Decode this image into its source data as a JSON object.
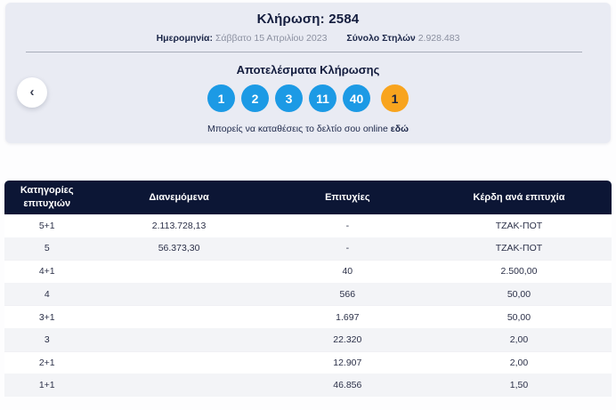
{
  "draw": {
    "title_label": "Κλήρωση:",
    "title_number": "2584",
    "date_label": "Ημερομηνία:",
    "date_value": "Σάββατο 15 Απριλίου 2023",
    "columns_label": "Σύνολο Στηλών",
    "columns_value": "2.928.483"
  },
  "results": {
    "heading": "Αποτελέσματα Κλήρωσης",
    "numbers": [
      "1",
      "2",
      "3",
      "11",
      "40"
    ],
    "joker": "1",
    "cta_text": "Μπορείς να καταθέσεις το δελτίο σου online",
    "cta_link": "εδώ",
    "back_icon_glyph": "‹"
  },
  "colors": {
    "card_bg": "#e9ebf3",
    "number_ball_blue": "#1c9ae5",
    "joker_ball_orange": "#f8a41e",
    "table_header_bg": "#0c1635",
    "navy_text": "#131c3d",
    "muted_text": "#8b90a0"
  },
  "table": {
    "headers": [
      "Κατηγορίες επιτυχιών",
      "Διανεμόμενα",
      "Επιτυχίες",
      "Κέρδη ανά επιτυχία"
    ],
    "rows": [
      {
        "category": "5+1",
        "distributed": "2.113.728,13",
        "winners": "-",
        "winnings": "ΤΖΑΚ-ΠΟΤ"
      },
      {
        "category": "5",
        "distributed": "56.373,30",
        "winners": "-",
        "winnings": "ΤΖΑΚ-ΠΟΤ"
      },
      {
        "category": "4+1",
        "distributed": "",
        "winners": "40",
        "winnings": "2.500,00"
      },
      {
        "category": "4",
        "distributed": "",
        "winners": "566",
        "winnings": "50,00"
      },
      {
        "category": "3+1",
        "distributed": "",
        "winners": "1.697",
        "winnings": "50,00"
      },
      {
        "category": "3",
        "distributed": "",
        "winners": "22.320",
        "winnings": "2,00"
      },
      {
        "category": "2+1",
        "distributed": "",
        "winners": "12.907",
        "winnings": "2,00"
      },
      {
        "category": "1+1",
        "distributed": "",
        "winners": "46.856",
        "winnings": "1,50"
      }
    ]
  }
}
